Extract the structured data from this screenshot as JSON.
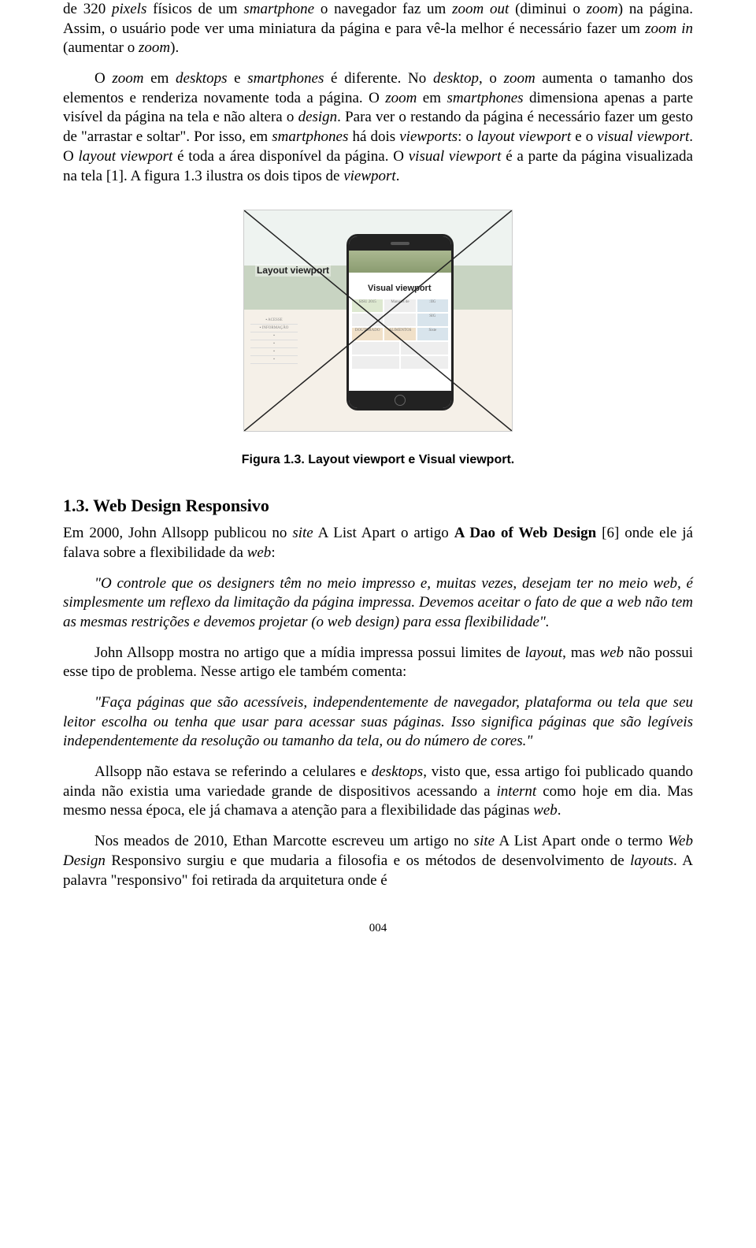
{
  "paragraphs": {
    "p1_a": "de 320 ",
    "p1_pixels": "pixels",
    "p1_b": " físicos de um ",
    "p1_smart1": "smartphone",
    "p1_c": " o navegador faz um ",
    "p1_zoomout": "zoom out",
    "p1_d": " (diminui o ",
    "p1_zoom1": "zoom",
    "p1_e": ") na página. Assim, o usuário pode ver uma miniatura da página e para vê-la melhor é necessário fazer um ",
    "p1_zoomin": "zoom in",
    "p1_f": " (aumentar o ",
    "p1_zoom2": "zoom",
    "p1_g": ").",
    "p2_a": "O ",
    "p2_zoom1": "zoom",
    "p2_b": " em ",
    "p2_desk1": "desktops",
    "p2_c": " e ",
    "p2_smart1": "smartphones",
    "p2_d": " é diferente. No ",
    "p2_desk2": "desktop",
    "p2_e": ", o ",
    "p2_zoom2": "zoom",
    "p2_f": " aumenta o tamanho dos elementos e renderiza novamente toda a página. O ",
    "p2_zoom3": "zoom",
    "p2_g": " em ",
    "p2_smart2": "smartphones",
    "p2_h": " dimensiona apenas a parte visível da página na tela e não altera o ",
    "p2_design": "design",
    "p2_i": ". Para ver o restando da página é necessário fazer um gesto de \"arrastar e soltar\". Por isso, em ",
    "p2_smart3": "smartphones",
    "p2_j": " há dois ",
    "p2_vp": "viewports",
    "p2_k": ": o ",
    "p2_lvp": "layout viewport",
    "p2_l": " e o ",
    "p2_vvp": "visual viewport",
    "p2_m": ". O ",
    "p2_lvp2": "layout viewport",
    "p2_n": " é toda a área disponível da página. O ",
    "p2_vvp2": "visual viewport",
    "p2_o": " é a parte da página visualizada na tela [1]. A figura 1.3 ilustra os dois tipos de ",
    "p2_vp2": "viewport",
    "p2_p": "."
  },
  "figure": {
    "layout_label": "Layout viewport",
    "visual_label": "Visual viewport",
    "phone_texts": {
      "sisu": "SISU 2015",
      "manuais": "Manuais de",
      "sig": "SIG",
      "doutorado": "DOUTORADO",
      "alimentos": "ALIMENTOS",
      "siste": "Siste"
    },
    "caption": "Figura 1.3. Layout viewport e Visual viewport."
  },
  "section": {
    "number": "1.3.",
    "title": "Web Design Responsivo"
  },
  "section_body": {
    "p1_a": "Em 2000, John Allsopp publicou no ",
    "p1_site": "site",
    "p1_b": " A List Apart o artigo ",
    "p1_bold": "A Dao of Web Design",
    "p1_c": " [6] onde ele já falava sobre a flexibilidade da ",
    "p1_web": "web",
    "p1_d": ":",
    "quote1": "\"O controle que os designers têm no meio impresso e, muitas vezes, desejam ter no meio web, é simplesmente um reflexo da limitação da página impressa. Devemos aceitar o fato de que a web não tem as mesmas restrições e devemos projetar (o web design) para essa flexibilidade\".",
    "p2_a": "John Allsopp mostra no artigo que a mídia impressa possui limites de ",
    "p2_layout": "layout",
    "p2_b": ", mas ",
    "p2_web": "web",
    "p2_c": " não possui esse tipo de problema. Nesse artigo ele também comenta:",
    "quote2": "\"Faça páginas que são acessíveis, independentemente de navegador, plataforma ou tela que seu leitor escolha ou tenha que usar para acessar suas páginas. Isso significa páginas que são legíveis independentemente da resolução ou tamanho da tela, ou do número de cores.\"",
    "p3_a": "Allsopp não estava se referindo a celulares e ",
    "p3_desktops": "desktops",
    "p3_b": ", visto que, essa artigo foi publicado quando ainda não existia uma variedade grande de dispositivos acessando a ",
    "p3_internt": "internt",
    "p3_c": " como hoje em dia. Mas mesmo nessa época, ele já chamava a atenção para a flexibilidade das páginas ",
    "p3_web": "web",
    "p3_d": ".",
    "p4_a": "Nos meados de 2010, Ethan Marcotte escreveu um artigo no ",
    "p4_site": "site",
    "p4_b": " A List Apart onde o termo ",
    "p4_wd": "Web Design",
    "p4_c": " Responsivo surgiu e que mudaria a filosofia e os métodos de desenvolvimento de ",
    "p4_layouts": "layouts",
    "p4_d": ". A palavra \"responsivo\" foi retirada da arquitetura onde é"
  },
  "page_number": "004"
}
